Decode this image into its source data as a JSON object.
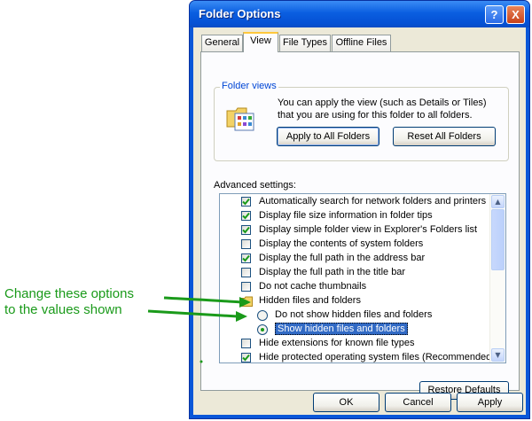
{
  "window": {
    "title": "Folder Options",
    "help_label": "?",
    "close_label": "X"
  },
  "tabs": [
    {
      "label": "General"
    },
    {
      "label": "View"
    },
    {
      "label": "File Types"
    },
    {
      "label": "Offline Files"
    }
  ],
  "folder_views": {
    "label": "Folder views",
    "description": "You can apply the view (such as Details or Tiles) that you are using for this folder to all folders.",
    "apply_button": "Apply to All Folders",
    "reset_button": "Reset All Folders"
  },
  "advanced": {
    "label": "Advanced settings:",
    "items": [
      {
        "type": "checkbox",
        "checked": true,
        "label": "Automatically search for network folders and printers"
      },
      {
        "type": "checkbox",
        "checked": true,
        "label": "Display file size information in folder tips"
      },
      {
        "type": "checkbox",
        "checked": true,
        "label": "Display simple folder view in Explorer's Folders list"
      },
      {
        "type": "checkbox",
        "checked": false,
        "label": "Display the contents of system folders"
      },
      {
        "type": "checkbox",
        "checked": true,
        "label": "Display the full path in the address bar"
      },
      {
        "type": "checkbox",
        "checked": false,
        "label": "Display the full path in the title bar"
      },
      {
        "type": "checkbox",
        "checked": false,
        "label": "Do not cache thumbnails"
      },
      {
        "type": "folder",
        "label": "Hidden files and folders"
      },
      {
        "type": "radio",
        "checked": false,
        "label": "Do not show hidden files and folders"
      },
      {
        "type": "radio",
        "checked": true,
        "label": "Show hidden files and folders"
      },
      {
        "type": "checkbox",
        "checked": false,
        "label": "Hide extensions for known file types"
      },
      {
        "type": "checkbox",
        "checked": true,
        "label": "Hide protected operating system files (Recommended)"
      }
    ],
    "restore_button": "Restore Defaults"
  },
  "footer": {
    "ok": "OK",
    "cancel": "Cancel",
    "apply": "Apply"
  },
  "annotation": {
    "line1": "Change these options",
    "line2": "to the values shown"
  },
  "colors": {
    "annotation": "#1a9a1a",
    "title_bar": "#0a5ee0",
    "check": "#1a9a1a"
  }
}
